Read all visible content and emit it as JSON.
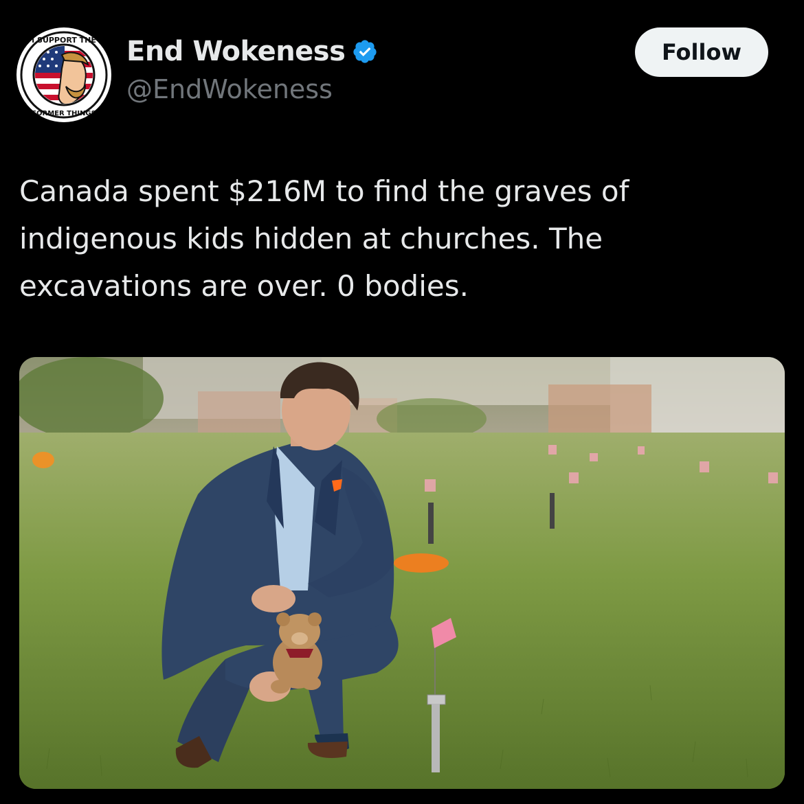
{
  "account": {
    "display_name": "End Wokeness",
    "handle": "@EndWokeness",
    "verified_icon": "verified-badge-icon",
    "verified_color": "#1d9bf0",
    "avatar_text_top": "I SUPPORT THE",
    "avatar_text_bottom": "FORMER THINGS"
  },
  "actions": {
    "follow_label": "Follow"
  },
  "tweet": {
    "lines": [
      "Canada spent $216M to find the graves of",
      "indigenous kids hidden at churches. The",
      "excavations are over. 0 bodies."
    ]
  },
  "media": {
    "description_icon": "photo-man-kneeling-with-teddy-bear",
    "accent_colors": {
      "grass": "#5d7a2e",
      "suit": "#2f4566",
      "flag": "#f08aa8",
      "shirt": "#ff6a1a"
    }
  }
}
